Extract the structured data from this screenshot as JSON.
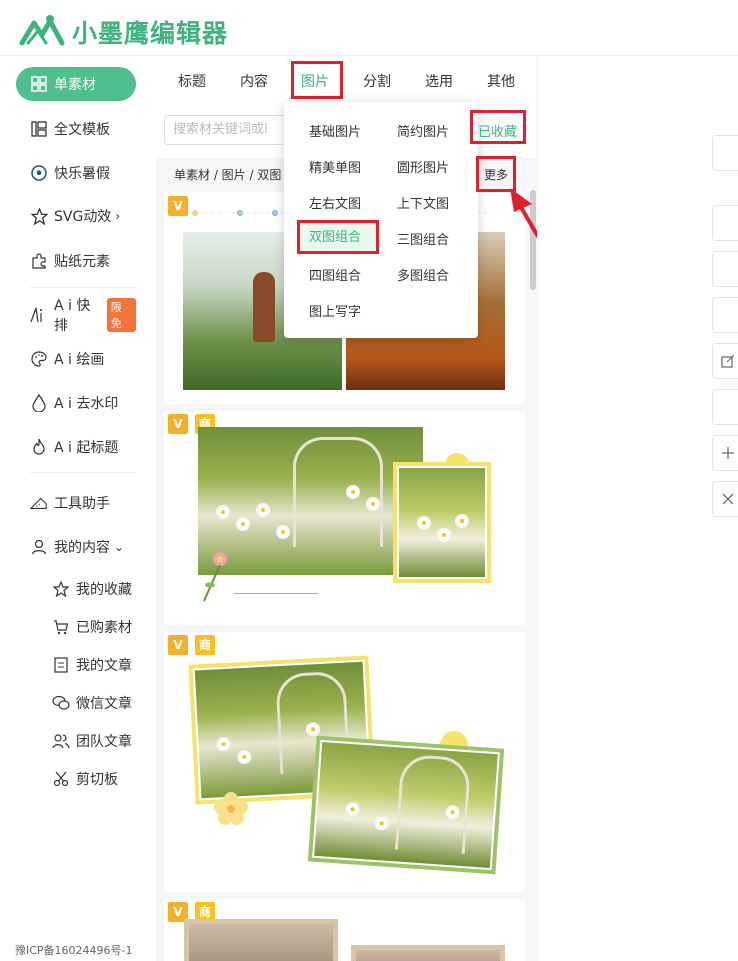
{
  "app": {
    "logo_text": "小墨鹰编辑器"
  },
  "sidebar": {
    "items": [
      {
        "label": "单素材",
        "icon": "grid-icon"
      },
      {
        "label": "全文模板",
        "icon": "template-icon"
      },
      {
        "label": "快乐暑假",
        "icon": "soccer-ball-icon"
      },
      {
        "label": "SVG动效",
        "icon": "star-icon",
        "chevron": "›"
      },
      {
        "label": "贴纸元素",
        "icon": "puzzle-icon"
      },
      {
        "label": "A i 快排",
        "icon": "ai-typeset-icon",
        "badge": "限免"
      },
      {
        "label": "A i 绘画",
        "icon": "palette-icon"
      },
      {
        "label": "A i 去水印",
        "icon": "drop-icon"
      },
      {
        "label": "A i 起标题",
        "icon": "flame-icon"
      },
      {
        "label": "工具助手",
        "icon": "ruler-icon"
      },
      {
        "label": "我的内容",
        "icon": "user-icon",
        "chevron": "⌄"
      }
    ],
    "sub_items": [
      {
        "label": "我的收藏",
        "icon": "star-outline-icon"
      },
      {
        "label": "已购素材",
        "icon": "cart-icon"
      },
      {
        "label": "我的文章",
        "icon": "document-icon"
      },
      {
        "label": "微信文章",
        "icon": "wechat-icon"
      },
      {
        "label": "团队文章",
        "icon": "team-icon"
      },
      {
        "label": "剪切板",
        "icon": "scissors-icon"
      }
    ],
    "icp": "豫ICP备16024496号-1"
  },
  "tabs": [
    "标题",
    "内容",
    "图片",
    "分割",
    "选用",
    "其他"
  ],
  "search": {
    "placeholder": "搜索材关键词或I"
  },
  "breadcrumb": "单素材 / 图片 / 双图",
  "dropdown": {
    "items": [
      "基础图片",
      "简约图片",
      "精美单图",
      "圆形图片",
      "左右文图",
      "上下文图",
      "双图组合",
      "三图组合",
      "四图组合",
      "多图组合",
      "图上写字"
    ],
    "favorites": "已收藏",
    "more": "更多"
  },
  "tags": {
    "v": "V",
    "shang": "商"
  },
  "colors": {
    "brand": "#4fc08d",
    "brand_text": "#3fb27f",
    "highlight": "#e0202a",
    "badge": "#f5743a"
  }
}
